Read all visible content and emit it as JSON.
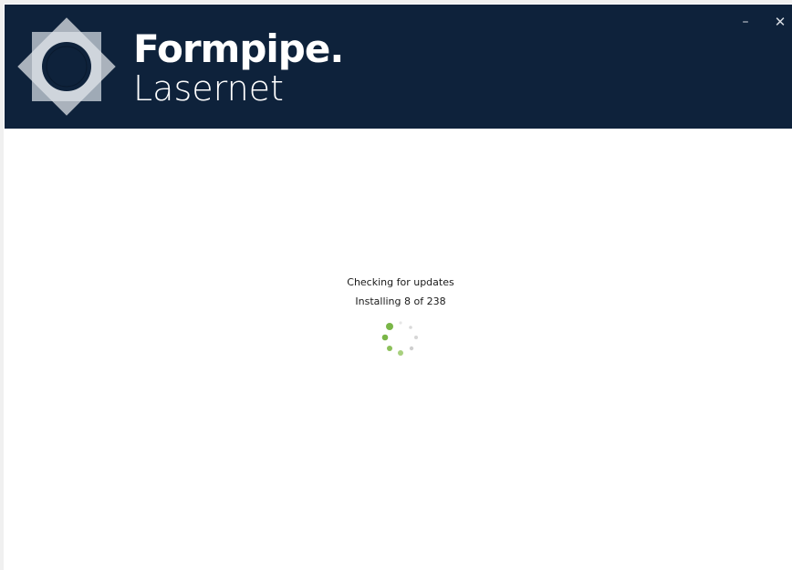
{
  "header": {
    "brand": "Formpipe.",
    "product": "Lasernet",
    "background_color": "#0e223b",
    "logo_icon": "formpipe-logo-icon"
  },
  "window_controls": {
    "minimize_label": "–",
    "close_label": "✕"
  },
  "status": {
    "title": "Checking for updates",
    "progress_text": "Installing 8 of 238",
    "spinner_icon": "loading-spinner-icon",
    "spinner_color": "#7ab648"
  }
}
